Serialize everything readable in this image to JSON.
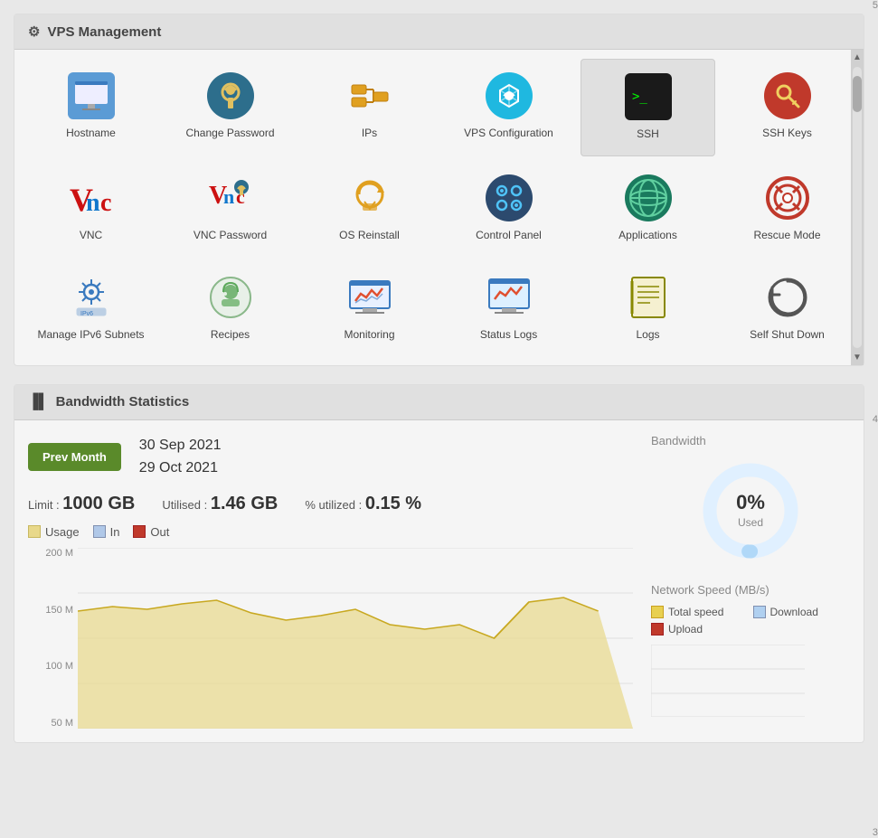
{
  "vps_management": {
    "title": "VPS Management",
    "icons": [
      {
        "id": "hostname",
        "label": "Hostname",
        "color": "#5b9bd5"
      },
      {
        "id": "change-password",
        "label": "Change Password",
        "color": "#2d6e8c"
      },
      {
        "id": "ips",
        "label": "IPs",
        "color": "#e8a020"
      },
      {
        "id": "vps-configuration",
        "label": "VPS Configuration",
        "color": "#1fb8e0"
      },
      {
        "id": "ssh",
        "label": "SSH",
        "color": "#222222",
        "active": true
      },
      {
        "id": "ssh-keys",
        "label": "SSH Keys",
        "color": "#c0392b"
      },
      {
        "id": "vnc",
        "label": "VNC",
        "color": "#cc1111"
      },
      {
        "id": "vnc-password",
        "label": "VNC Password",
        "color": "#cc1111"
      },
      {
        "id": "os-reinstall",
        "label": "OS Reinstall",
        "color": "#e8a020"
      },
      {
        "id": "control-panel",
        "label": "Control Panel",
        "color": "#2c4a6e"
      },
      {
        "id": "applications",
        "label": "Applications",
        "color": "#1a7a5e"
      },
      {
        "id": "rescue-mode",
        "label": "Rescue Mode",
        "color": "#cc1111"
      },
      {
        "id": "manage-ipv6",
        "label": "Manage IPv6 Subnets",
        "color": "#3a7abf"
      },
      {
        "id": "recipes",
        "label": "Recipes",
        "color": "#5ba85a"
      },
      {
        "id": "monitoring",
        "label": "Monitoring",
        "color": "#3a7abf"
      },
      {
        "id": "status-logs",
        "label": "Status Logs",
        "color": "#3a7abf"
      },
      {
        "id": "logs",
        "label": "Logs",
        "color": "#888800"
      },
      {
        "id": "self-shut-down",
        "label": "Self Shut Down",
        "color": "#333333"
      }
    ]
  },
  "bandwidth": {
    "title": "Bandwidth Statistics",
    "prev_month_label": "Prev Month",
    "date_from": "30 Sep 2021",
    "date_to": "29 Oct 2021",
    "limit_label": "Limit :",
    "limit_value": "1000 GB",
    "utilised_label": "Utilised :",
    "utilised_value": "1.46 GB",
    "percent_label": "% utilized :",
    "percent_value": "0.15 %",
    "donut_label": "Bandwidth",
    "donut_percent": "0%",
    "donut_used": "Used",
    "legend": [
      {
        "label": "Usage",
        "color": "#e8d88a"
      },
      {
        "label": "In",
        "color": "#b0c8e8"
      },
      {
        "label": "Out",
        "color": "#c0392b"
      }
    ],
    "y_axis": [
      "200 M",
      "150 M",
      "100 M",
      "50 M"
    ],
    "network_speed_title": "Network Speed (MB/s)",
    "network_legend": [
      {
        "label": "Total speed",
        "color": "#e8d050"
      },
      {
        "label": "Download",
        "color": "#b0d0f0"
      },
      {
        "label": "Upload",
        "color": "#c0392b"
      }
    ],
    "speed_y_axis": [
      "5",
      "4",
      "3"
    ]
  }
}
